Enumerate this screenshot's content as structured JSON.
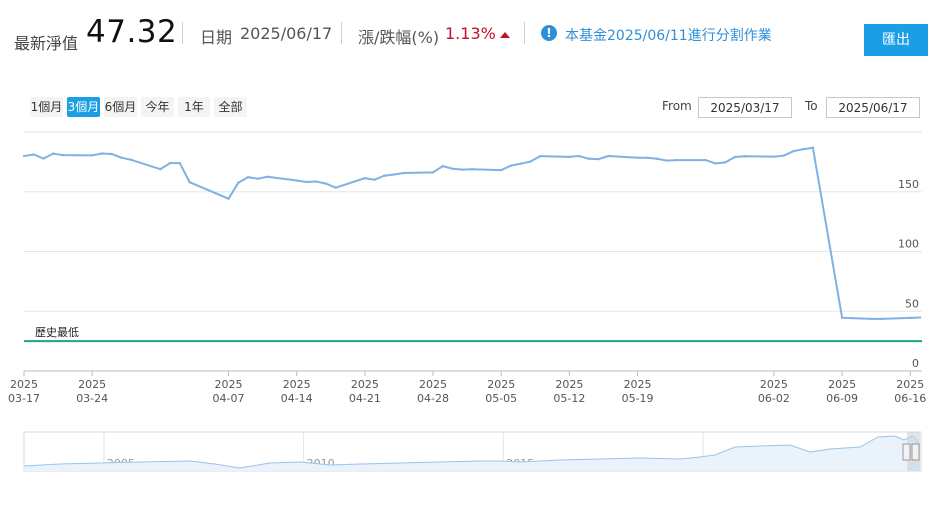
{
  "header": {
    "nav_label": "最新淨值",
    "nav_value": "47.32",
    "date_label": "日期",
    "date_value": "2025/06/17",
    "change_label": "漲/跌幅(%)",
    "change_value": "1.13%",
    "change_direction": "up",
    "change_color": "#c0112c",
    "info_icon": "info-icon",
    "notice": "本基金2025/06/11進行分割作業",
    "export_label": "匯出"
  },
  "range_selector": {
    "buttons": [
      "1個月",
      "3個月",
      "6個月",
      "今年",
      "1年",
      "全部"
    ],
    "active": "3個月",
    "from_label": "From",
    "from_value": "2025/03/17",
    "to_label": "To",
    "to_value": "2025/06/17"
  },
  "colors": {
    "accent": "#1a9ee5",
    "series_line": "#7fb2e3",
    "low_line": "#1aa48a",
    "navigator_fill": "#eaf2fb"
  },
  "chart_data": {
    "type": "line",
    "ylim": [
      0,
      200
    ],
    "yticks": [
      0,
      50,
      100,
      150
    ],
    "x_tick_labels": [
      [
        "2025",
        "03-17"
      ],
      [
        "2025",
        "03-24"
      ],
      [
        "2025",
        "04-07"
      ],
      [
        "2025",
        "04-14"
      ],
      [
        "2025",
        "04-21"
      ],
      [
        "2025",
        "04-28"
      ],
      [
        "2025",
        "05-05"
      ],
      [
        "2025",
        "05-12"
      ],
      [
        "2025",
        "05-19"
      ],
      [
        "2025",
        "06-02"
      ],
      [
        "2025",
        "06-09"
      ],
      [
        "2025",
        "06-16"
      ]
    ],
    "x_tick_dates": [
      "2025-03-17",
      "2025-03-24",
      "2025-04-07",
      "2025-04-14",
      "2025-04-21",
      "2025-04-28",
      "2025-05-05",
      "2025-05-12",
      "2025-05-19",
      "2025-06-02",
      "2025-06-09",
      "2025-06-16"
    ],
    "x_range": [
      "2025-03-17",
      "2025-06-17"
    ],
    "series": [
      {
        "values": [
          [
            "2025-03-17",
            179.9
          ],
          [
            "2025-03-18",
            181.2
          ],
          [
            "2025-03-19",
            177.8
          ],
          [
            "2025-03-20",
            181.9
          ],
          [
            "2025-03-21",
            180.7
          ],
          [
            "2025-03-24",
            180.4
          ],
          [
            "2025-03-25",
            182.0
          ],
          [
            "2025-03-26",
            181.6
          ],
          [
            "2025-03-27",
            178.5
          ],
          [
            "2025-03-28",
            176.7
          ],
          [
            "2025-03-31",
            168.9
          ],
          [
            "2025-04-01",
            174.0
          ],
          [
            "2025-04-02",
            174.0
          ],
          [
            "2025-04-03",
            158.0
          ],
          [
            "2025-04-07",
            144.2
          ],
          [
            "2025-04-08",
            157.5
          ],
          [
            "2025-04-09",
            162.2
          ],
          [
            "2025-04-10",
            160.9
          ],
          [
            "2025-04-11",
            162.5
          ],
          [
            "2025-04-14",
            159.4
          ],
          [
            "2025-04-15",
            158.2
          ],
          [
            "2025-04-16",
            158.6
          ],
          [
            "2025-04-17",
            156.8
          ],
          [
            "2025-04-18",
            153.4
          ],
          [
            "2025-04-21",
            161.3
          ],
          [
            "2025-04-22",
            160.1
          ],
          [
            "2025-04-23",
            163.4
          ],
          [
            "2025-04-24",
            164.4
          ],
          [
            "2025-04-25",
            165.7
          ],
          [
            "2025-04-28",
            166.2
          ],
          [
            "2025-04-29",
            171.5
          ],
          [
            "2025-04-30",
            169.3
          ],
          [
            "2025-05-01",
            168.5
          ],
          [
            "2025-05-02",
            168.9
          ],
          [
            "2025-05-05",
            168.1
          ],
          [
            "2025-05-06",
            171.9
          ],
          [
            "2025-05-07",
            173.5
          ],
          [
            "2025-05-08",
            175.2
          ],
          [
            "2025-05-09",
            179.8
          ],
          [
            "2025-05-12",
            179.2
          ],
          [
            "2025-05-13",
            179.9
          ],
          [
            "2025-05-14",
            177.6
          ],
          [
            "2025-05-15",
            177.3
          ],
          [
            "2025-05-16",
            179.9
          ],
          [
            "2025-05-19",
            178.5
          ],
          [
            "2025-05-20",
            178.5
          ],
          [
            "2025-05-21",
            177.6
          ],
          [
            "2025-05-22",
            176.1
          ],
          [
            "2025-05-23",
            176.5
          ],
          [
            "2025-05-26",
            176.5
          ],
          [
            "2025-05-27",
            173.6
          ],
          [
            "2025-05-28",
            174.6
          ],
          [
            "2025-05-29",
            179.1
          ],
          [
            "2025-05-30",
            179.7
          ],
          [
            "2025-06-02",
            179.4
          ],
          [
            "2025-06-03",
            180.2
          ],
          [
            "2025-06-04",
            183.9
          ],
          [
            "2025-06-05",
            185.6
          ],
          [
            "2025-06-06",
            186.9
          ],
          [
            "2025-06-09",
            44.6
          ],
          [
            "2025-06-10",
            44.3
          ],
          [
            "2025-06-11",
            43.9
          ],
          [
            "2025-06-12",
            43.6
          ],
          [
            "2025-06-13",
            43.6
          ],
          [
            "2025-06-16",
            44.4
          ],
          [
            "2025-06-17",
            44.8
          ]
        ]
      }
    ],
    "plot_lines": [
      {
        "label": "歷史最低",
        "value": 25
      }
    ],
    "navigator": {
      "year_labels": [
        "2005",
        "2010",
        "2015",
        "2020"
      ],
      "year_dates": [
        "2005-01-01",
        "2010-01-01",
        "2015-01-01",
        "2020-01-01"
      ]
    }
  }
}
